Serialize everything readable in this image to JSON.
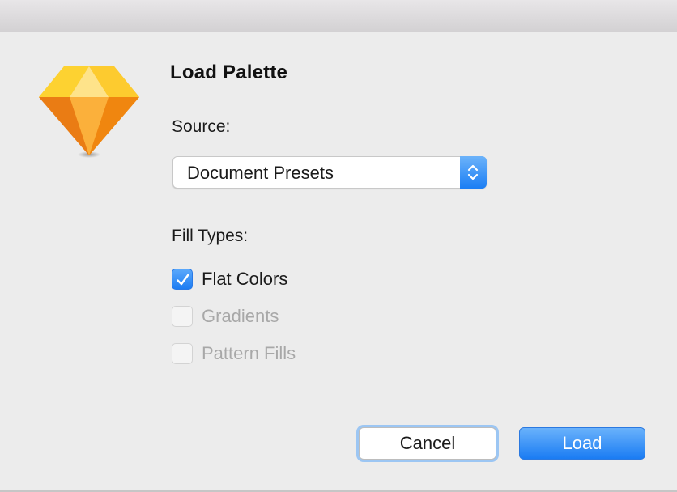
{
  "dialog": {
    "title": "Load Palette"
  },
  "source": {
    "label": "Source:",
    "selected": "Document Presets"
  },
  "fill_types": {
    "label": "Fill Types:",
    "options": [
      {
        "label": "Flat Colors",
        "checked": true,
        "enabled": true
      },
      {
        "label": "Gradients",
        "checked": false,
        "enabled": false
      },
      {
        "label": "Pattern Fills",
        "checked": false,
        "enabled": false
      }
    ]
  },
  "buttons": {
    "cancel": "Cancel",
    "load": "Load"
  },
  "icons": {
    "app": "sketch-diamond-icon",
    "stepper": "chevron-up-down-icon",
    "check": "checkmark-icon"
  },
  "colors": {
    "accent": "#1d7df3",
    "icon_orange": "#f59a23",
    "icon_yellow": "#fdd231"
  }
}
